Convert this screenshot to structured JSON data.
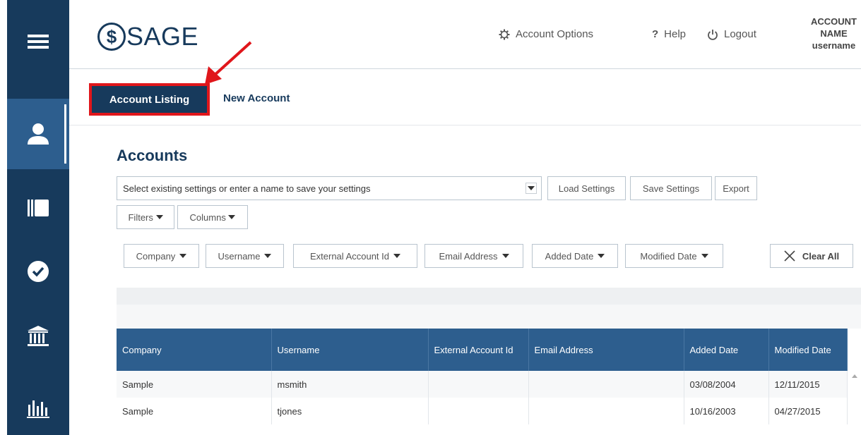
{
  "header": {
    "logo_text": "SAGE",
    "account_options": "Account Options",
    "help": "Help",
    "logout": "Logout",
    "account_line1": "ACCOUNT",
    "account_line2": "NAME",
    "account_line3": "username"
  },
  "tabs": {
    "active": "Account Listing",
    "second": "New Account"
  },
  "main": {
    "heading": "Accounts",
    "settings_placeholder": "Select existing settings or enter a name to save your settings",
    "load_settings": "Load Settings",
    "save_settings": "Save Settings",
    "export": "Export",
    "filters": "Filters",
    "columns": "Columns"
  },
  "filterbar": {
    "items": [
      "Company",
      "Username",
      "External Account Id",
      "Email Address",
      "Added Date",
      "Modified Date"
    ],
    "clear_all": "Clear All"
  },
  "table": {
    "headers": [
      "Company",
      "Username",
      "External Account Id",
      "Email Address",
      "Added Date",
      "Modified Date"
    ],
    "rows": [
      [
        "Sample",
        "msmith",
        "",
        "",
        "03/08/2004",
        "12/11/2015"
      ],
      [
        "Sample",
        "tjones",
        "",
        "",
        "10/16/2003",
        "04/27/2015"
      ]
    ]
  },
  "colors": {
    "nav": "#173a5c",
    "nav_active": "#2d5e8e",
    "annotation": "#e0161b"
  }
}
